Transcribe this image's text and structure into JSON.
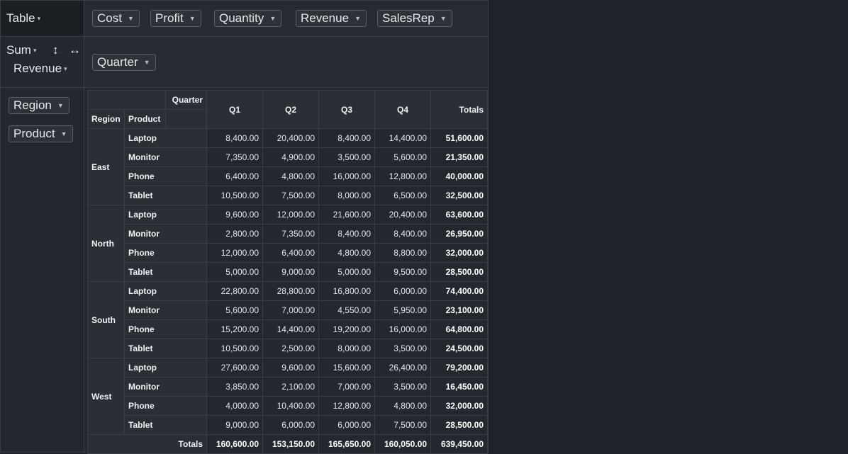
{
  "renderer": {
    "label": "Table"
  },
  "aggregator": {
    "label": "Sum",
    "attribute": "Revenue",
    "sort_rows_icon": "↕",
    "sort_cols_icon": "↔"
  },
  "unused_fields": [
    "Cost",
    "Profit",
    "Quantity",
    "Revenue",
    "SalesRep"
  ],
  "col_fields": [
    "Quarter"
  ],
  "row_fields": [
    "Region",
    "Product"
  ],
  "caret": "▾",
  "pill_caret": "▼",
  "table": {
    "col_attr_label": "Quarter",
    "row_attr_labels": [
      "Region",
      "Product"
    ],
    "col_headers": [
      "Q1",
      "Q2",
      "Q3",
      "Q4"
    ],
    "totals_label": "Totals",
    "groups": [
      {
        "region": "East",
        "rows": [
          {
            "product": "Laptop",
            "values": [
              "8,400.00",
              "20,400.00",
              "8,400.00",
              "14,400.00"
            ],
            "total": "51,600.00"
          },
          {
            "product": "Monitor",
            "values": [
              "7,350.00",
              "4,900.00",
              "3,500.00",
              "5,600.00"
            ],
            "total": "21,350.00"
          },
          {
            "product": "Phone",
            "values": [
              "6,400.00",
              "4,800.00",
              "16,000.00",
              "12,800.00"
            ],
            "total": "40,000.00"
          },
          {
            "product": "Tablet",
            "values": [
              "10,500.00",
              "7,500.00",
              "8,000.00",
              "6,500.00"
            ],
            "total": "32,500.00"
          }
        ]
      },
      {
        "region": "North",
        "rows": [
          {
            "product": "Laptop",
            "values": [
              "9,600.00",
              "12,000.00",
              "21,600.00",
              "20,400.00"
            ],
            "total": "63,600.00"
          },
          {
            "product": "Monitor",
            "values": [
              "2,800.00",
              "7,350.00",
              "8,400.00",
              "8,400.00"
            ],
            "total": "26,950.00"
          },
          {
            "product": "Phone",
            "values": [
              "12,000.00",
              "6,400.00",
              "4,800.00",
              "8,800.00"
            ],
            "total": "32,000.00"
          },
          {
            "product": "Tablet",
            "values": [
              "5,000.00",
              "9,000.00",
              "5,000.00",
              "9,500.00"
            ],
            "total": "28,500.00"
          }
        ]
      },
      {
        "region": "South",
        "rows": [
          {
            "product": "Laptop",
            "values": [
              "22,800.00",
              "28,800.00",
              "16,800.00",
              "6,000.00"
            ],
            "total": "74,400.00"
          },
          {
            "product": "Monitor",
            "values": [
              "5,600.00",
              "7,000.00",
              "4,550.00",
              "5,950.00"
            ],
            "total": "23,100.00"
          },
          {
            "product": "Phone",
            "values": [
              "15,200.00",
              "14,400.00",
              "19,200.00",
              "16,000.00"
            ],
            "total": "64,800.00"
          },
          {
            "product": "Tablet",
            "values": [
              "10,500.00",
              "2,500.00",
              "8,000.00",
              "3,500.00"
            ],
            "total": "24,500.00"
          }
        ]
      },
      {
        "region": "West",
        "rows": [
          {
            "product": "Laptop",
            "values": [
              "27,600.00",
              "9,600.00",
              "15,600.00",
              "26,400.00"
            ],
            "total": "79,200.00"
          },
          {
            "product": "Monitor",
            "values": [
              "3,850.00",
              "2,100.00",
              "7,000.00",
              "3,500.00"
            ],
            "total": "16,450.00"
          },
          {
            "product": "Phone",
            "values": [
              "4,000.00",
              "10,400.00",
              "12,800.00",
              "4,800.00"
            ],
            "total": "32,000.00"
          },
          {
            "product": "Tablet",
            "values": [
              "9,000.00",
              "6,000.00",
              "6,000.00",
              "7,500.00"
            ],
            "total": "28,500.00"
          }
        ]
      }
    ],
    "col_totals": [
      "160,600.00",
      "153,150.00",
      "165,650.00",
      "160,050.00"
    ],
    "grand_total": "639,450.00"
  }
}
